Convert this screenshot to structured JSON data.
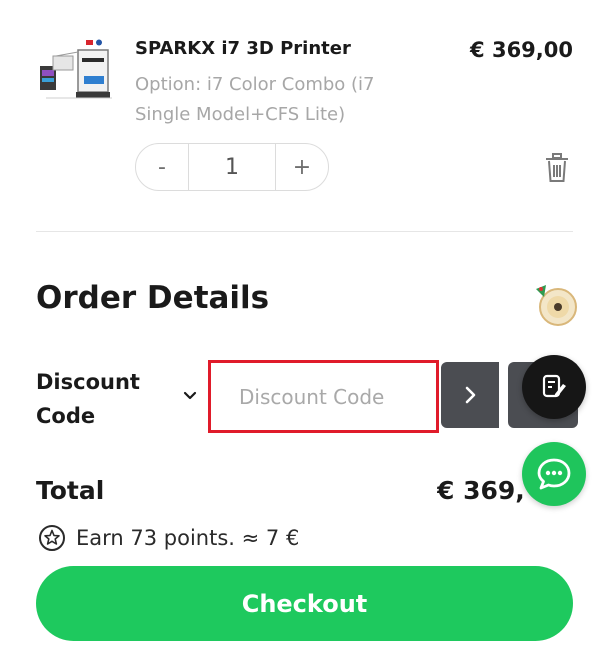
{
  "product": {
    "name": "SPARKX i7 3D Printer",
    "price": "€ 369,00",
    "option_line1": "Option: i7 Color Combo (i7",
    "option_line2": "Single Model+CFS Lite)",
    "quantity": "1",
    "minus_label": "-",
    "plus_label": "+",
    "image_icon": "3d-printer-product-image"
  },
  "order": {
    "title": "Order Details",
    "discount_label_line1": "Discount",
    "discount_label_line2": "Code",
    "discount_placeholder": "Discount Code",
    "highlight_color": "#e01b2a",
    "total_label": "Total",
    "total_value": "€ 369,00",
    "points_text": "Earn 73 points. ≈ 7 €",
    "checkout_label": "Checkout"
  },
  "colors": {
    "checkout_green": "#1ec95e",
    "chat_green": "#1fc55c",
    "button_dark": "#4b4d52",
    "text_muted": "#a7a7a7"
  },
  "icons": {
    "trash": "trash-icon",
    "chevron": "chevron-down-icon",
    "apply": "chevron-right-icon",
    "edit": "edit-note-icon",
    "chat": "chat-bubble-icon",
    "points": "star-circle-icon",
    "badge": "reward-badge-icon"
  }
}
